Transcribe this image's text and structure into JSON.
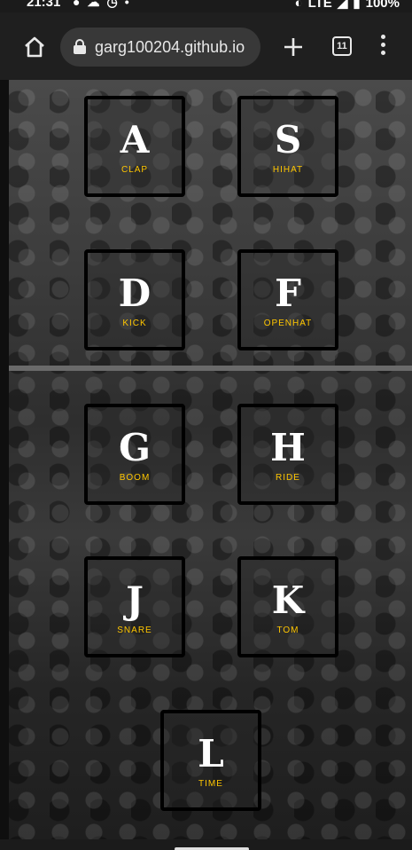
{
  "status_bar": {
    "time": "21:31",
    "left_icons": [
      "chat-icon",
      "cloud-icon",
      "alarm-icon",
      "dot-icon"
    ],
    "network": "LTE",
    "battery": "100%"
  },
  "browser": {
    "url": "garg100204.github.io",
    "tab_count": "11"
  },
  "keys": [
    {
      "key": "A",
      "sound": "clap"
    },
    {
      "key": "S",
      "sound": "hihat"
    },
    {
      "key": "D",
      "sound": "kick"
    },
    {
      "key": "F",
      "sound": "openhat"
    },
    {
      "key": "G",
      "sound": "boom"
    },
    {
      "key": "H",
      "sound": "ride"
    },
    {
      "key": "J",
      "sound": "snare"
    },
    {
      "key": "K",
      "sound": "tom"
    },
    {
      "key": "L",
      "sound": "time"
    }
  ]
}
